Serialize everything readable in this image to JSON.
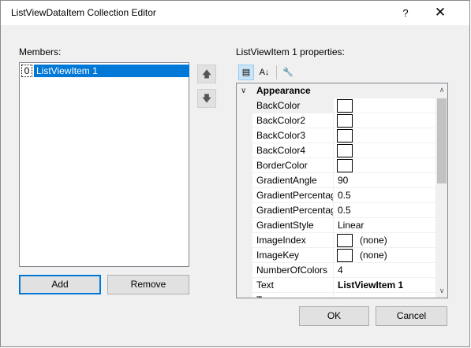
{
  "window": {
    "title": "ListViewDataItem Collection Editor",
    "help_glyph": "?",
    "close_glyph": "✕"
  },
  "members": {
    "label": "Members:",
    "items": [
      {
        "index": "0",
        "name": "ListViewItem 1"
      }
    ],
    "up_glyph": "🡅",
    "down_glyph": "🡇",
    "add_label": "Add",
    "remove_label": "Remove"
  },
  "properties": {
    "label": "ListViewItem 1 properties:",
    "toolbar": {
      "categorized_icon": "▤",
      "alphabetical_icon": "A↓",
      "property_pages_icon": "🔧"
    },
    "category": {
      "toggle": "∨",
      "name": "Appearance"
    },
    "rows": [
      {
        "name": "BackColor",
        "value": "",
        "swatch": true
      },
      {
        "name": "BackColor2",
        "value": "",
        "swatch": true
      },
      {
        "name": "BackColor3",
        "value": "",
        "swatch": true
      },
      {
        "name": "BackColor4",
        "value": "",
        "swatch": true
      },
      {
        "name": "BorderColor",
        "value": "",
        "swatch": true
      },
      {
        "name": "GradientAngle",
        "value": "90",
        "swatch": false
      },
      {
        "name": "GradientPercentag",
        "value": "0.5",
        "swatch": false
      },
      {
        "name": "GradientPercentag",
        "value": "0.5",
        "swatch": false
      },
      {
        "name": "GradientStyle",
        "value": "Linear",
        "swatch": false
      },
      {
        "name": "ImageIndex",
        "value": "(none)",
        "swatch": true
      },
      {
        "name": "ImageKey",
        "value": "(none)",
        "swatch": true
      },
      {
        "name": "NumberOfColors",
        "value": "4",
        "swatch": false
      },
      {
        "name": "Text",
        "value": "ListViewItem 1",
        "swatch": false,
        "bold": true
      },
      {
        "name": "T",
        "value": "",
        "swatch": false
      }
    ],
    "scroll_up_glyph": "∧",
    "scroll_down_glyph": "∨"
  },
  "footer": {
    "ok_label": "OK",
    "cancel_label": "Cancel"
  }
}
